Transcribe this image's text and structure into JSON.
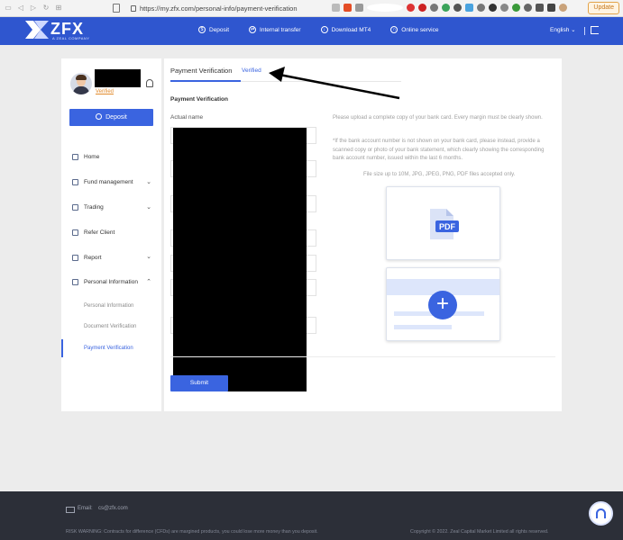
{
  "browser": {
    "url": "https://my.zfx.com/personal-info/payment-verification",
    "update_label": "Update"
  },
  "header": {
    "logo_text": "ZFX",
    "logo_sub": "A ZEAL COMPANY",
    "nav": [
      {
        "label": "Deposit",
        "icon": "dollar-circle-icon"
      },
      {
        "label": "Internal transfer",
        "icon": "transfer-icon"
      },
      {
        "label": "Download MT4",
        "icon": "download-icon"
      },
      {
        "label": "Online service",
        "icon": "headset-icon"
      }
    ],
    "language": "English"
  },
  "sidebar": {
    "verified_label": "Verified",
    "deposit_label": "Deposit",
    "menu": [
      {
        "label": "Home",
        "icon": "home-icon",
        "has_chevron": false
      },
      {
        "label": "Fund management",
        "icon": "wallet-icon",
        "has_chevron": true
      },
      {
        "label": "Trading",
        "icon": "trading-icon",
        "has_chevron": true
      },
      {
        "label": "Refer Client",
        "icon": "user-icon",
        "has_chevron": false
      },
      {
        "label": "Report",
        "icon": "report-icon",
        "has_chevron": true
      },
      {
        "label": "Personal Information",
        "icon": "gear-icon",
        "has_chevron": true,
        "expanded": true
      }
    ],
    "submenu": [
      {
        "label": "Personal Information",
        "active": false
      },
      {
        "label": "Document Verification",
        "active": false
      },
      {
        "label": "Payment Verification",
        "active": true
      }
    ]
  },
  "main": {
    "tab_title": "Payment Verification",
    "tab_status": "Verified",
    "section_title": "Payment Verification",
    "field_actual_name": "Actual name",
    "hint_1": "Please upload a complete copy of your bank card. Every margin must be clearly shown.",
    "hint_2": "*If the bank account number is not shown on your bank card, please instead, provide a scanned copy or photo of your bank statement, which clearly showing the corresponding bank account number, issued within the last 6 months.",
    "file_types": "File size up to 10M, JPG, JPEG, PNG, PDF files accepted only.",
    "pdf_label": "PDF",
    "submit_label": "Submit"
  },
  "footer": {
    "email_label": "Email:",
    "email_value": "cs@zfx.com",
    "risk_warning": "RISK WARNING: Contracts for difference (CFDs) are margined products, you could lose more money than you deposit.",
    "copyright": "Copyright © 2022. Zeal Capital Market Limited all rights reserved."
  },
  "colors": {
    "brand": "#2f56cf",
    "accent": "#3a64e0",
    "verified_orange": "#e18a2c",
    "footer_bg": "#2c2f38"
  }
}
